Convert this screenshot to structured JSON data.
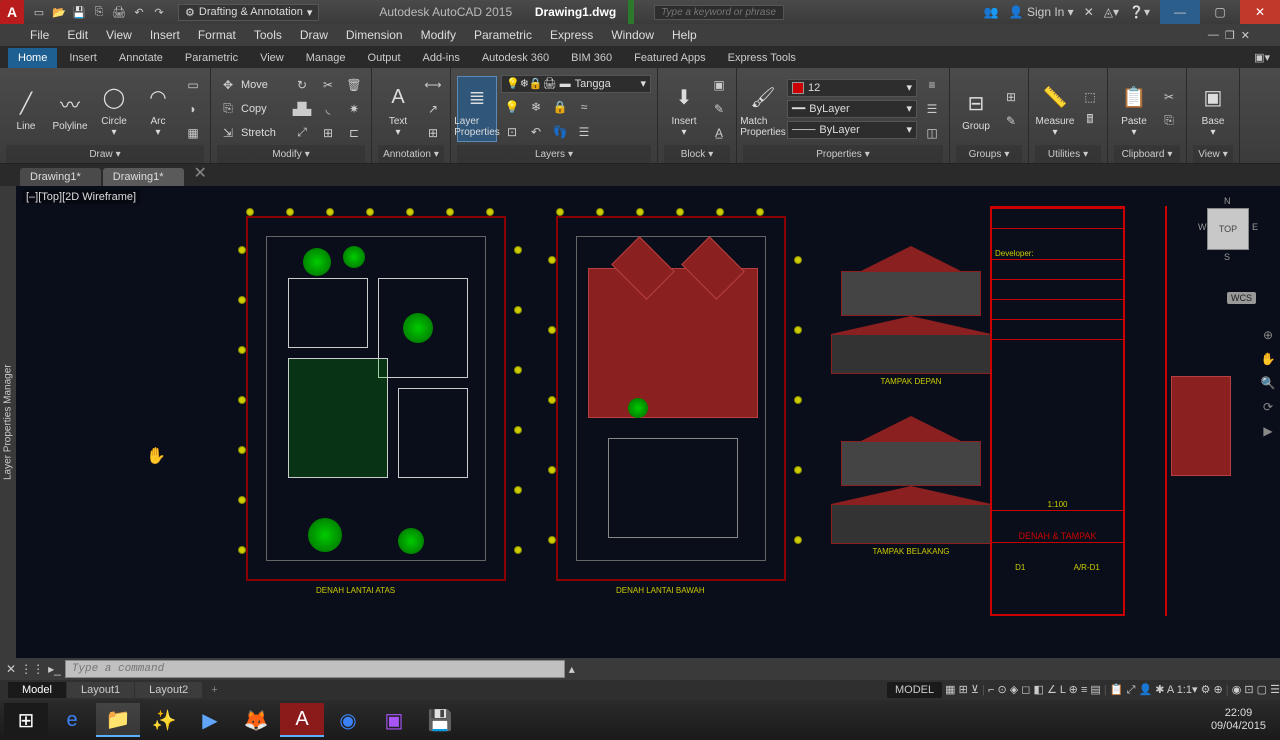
{
  "titlebar": {
    "workspace": "Drafting & Annotation",
    "app": "Autodesk AutoCAD 2015",
    "doc": "Drawing1.dwg",
    "search_placeholder": "Type a keyword or phrase",
    "signin": "Sign In"
  },
  "menus": [
    "File",
    "Edit",
    "View",
    "Insert",
    "Format",
    "Tools",
    "Draw",
    "Dimension",
    "Modify",
    "Parametric",
    "Express",
    "Window",
    "Help"
  ],
  "ribtabs": [
    "Home",
    "Insert",
    "Annotate",
    "Parametric",
    "View",
    "Manage",
    "Output",
    "Add-ins",
    "Autodesk 360",
    "BIM 360",
    "Featured Apps",
    "Express Tools"
  ],
  "ribbon": {
    "draw": {
      "title": "Draw",
      "line": "Line",
      "polyline": "Polyline",
      "circle": "Circle",
      "arc": "Arc"
    },
    "modify": {
      "title": "Modify",
      "move": "Move",
      "copy": "Copy",
      "stretch": "Stretch"
    },
    "annotation": {
      "title": "Annotation",
      "text": "Text"
    },
    "layers": {
      "title": "Layers",
      "btn": "Layer Properties",
      "current": "Tangga"
    },
    "block": {
      "title": "Block",
      "insert": "Insert"
    },
    "properties": {
      "title": "Properties",
      "match": "Match Properties",
      "color": "12",
      "line1": "ByLayer",
      "line2": "ByLayer"
    },
    "groups": {
      "title": "Groups",
      "group": "Group"
    },
    "utilities": {
      "title": "Utilities",
      "measure": "Measure"
    },
    "clipboard": {
      "title": "Clipboard",
      "paste": "Paste"
    },
    "view": {
      "title": "View",
      "base": "Base"
    }
  },
  "filetabs": [
    "Drawing1*",
    "Drawing1*"
  ],
  "viewport": {
    "label": "[–][Top][2D Wireframe]",
    "cube": "TOP",
    "wcs": "WCS",
    "n": "N",
    "s": "S",
    "e": "E",
    "w": "W"
  },
  "sidepanel": "Layer Properties Manager",
  "drawing": {
    "plan1_label": "DENAH LANTAI ATAS",
    "plan2_label": "DENAH LANTAI BAWAH",
    "elev1_label": "TAMPAK DEPAN",
    "elev2_label": "TAMPAK BELAKANG",
    "tb_developer": "Developer:",
    "tb_scale": "1:100",
    "tb_title": "DENAH & TAMPAK",
    "tb_code1": "D1",
    "tb_code2": "A/R-D1"
  },
  "cmd": {
    "placeholder": "Type a command"
  },
  "layouts": {
    "model": "Model",
    "l1": "Layout1",
    "l2": "Layout2"
  },
  "status": {
    "model": "MODEL",
    "scale": "1:1"
  },
  "taskbar": {
    "time": "22:09",
    "date": "09/04/2015"
  }
}
